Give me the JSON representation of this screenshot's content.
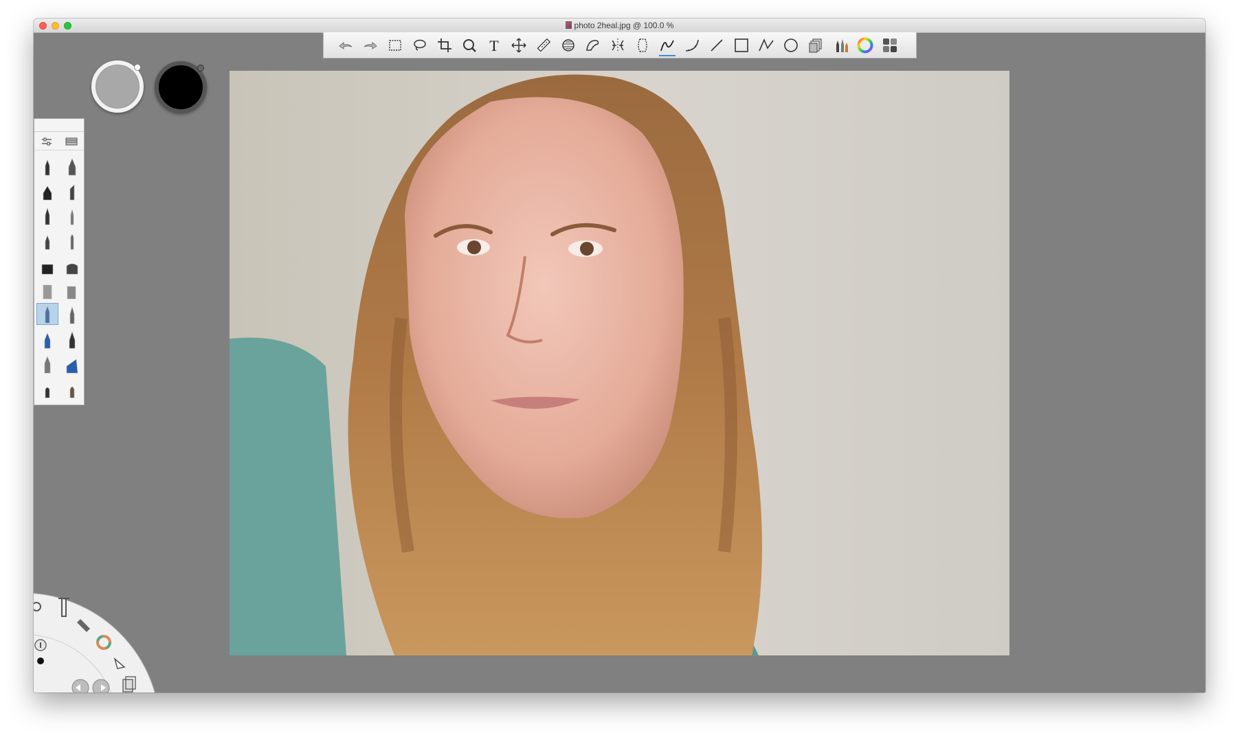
{
  "window": {
    "title": "photo 2heal.jpg @ 100.0 %"
  },
  "colors": {
    "canvas_background": "#808080",
    "primary_swatch": "#a8a8a8",
    "secondary_swatch": "#000000",
    "accent": "#3d8bd9"
  },
  "toolbar": {
    "tools": [
      {
        "name": "undo-icon"
      },
      {
        "name": "redo-icon"
      },
      {
        "name": "rect-select-icon"
      },
      {
        "name": "lasso-icon"
      },
      {
        "name": "crop-icon"
      },
      {
        "name": "zoom-icon"
      },
      {
        "name": "text-icon",
        "glyph": "T"
      },
      {
        "name": "move-icon"
      },
      {
        "name": "ruler-icon"
      },
      {
        "name": "ellipse-guide-icon"
      },
      {
        "name": "french-curve-icon"
      },
      {
        "name": "symmetry-icon"
      },
      {
        "name": "distort-icon"
      },
      {
        "name": "stroke-icon",
        "active": true
      },
      {
        "name": "curve-icon"
      },
      {
        "name": "line-icon"
      },
      {
        "name": "rectangle-icon"
      },
      {
        "name": "polyline-icon"
      },
      {
        "name": "circle-icon"
      },
      {
        "name": "layers-icon"
      },
      {
        "name": "brush-library-icon"
      },
      {
        "name": "color-wheel-icon"
      },
      {
        "name": "copic-colors-icon"
      }
    ]
  },
  "brush_palette": {
    "header_icons": [
      "brush-properties-icon",
      "brush-list-icon"
    ],
    "selected_index": 12,
    "count": 20
  },
  "lagoon": {
    "items": [
      "settings-icon",
      "brush-icon",
      "airbrush-icon",
      "color-wheel-icon",
      "info-icon",
      "dot-icon",
      "select-icon",
      "undo-icon",
      "redo-icon",
      "layers-icon"
    ]
  }
}
